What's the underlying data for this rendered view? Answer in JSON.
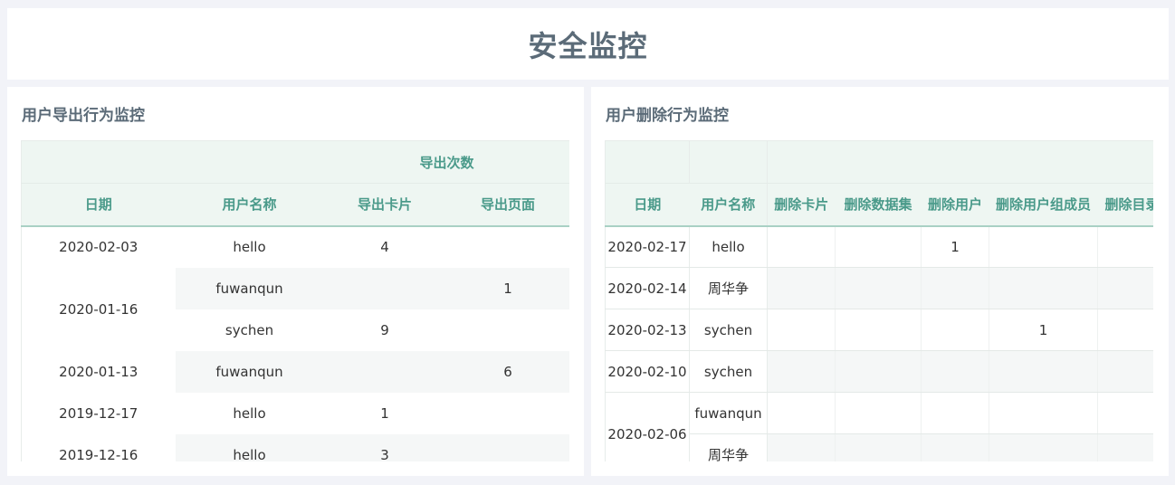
{
  "page": {
    "title": "安全监控"
  },
  "export_panel": {
    "title": "用户导出行为监控",
    "group_header": "导出次数",
    "columns": [
      "日期",
      "用户名称",
      "导出卡片",
      "导出页面"
    ],
    "rows": [
      {
        "date": "2020-02-03",
        "user": "hello",
        "cards": "4",
        "pages": ""
      },
      {
        "date": "2020-01-16",
        "user": "fuwanqun",
        "cards": "",
        "pages": "1"
      },
      {
        "date": "",
        "user": "sychen",
        "cards": "9",
        "pages": ""
      },
      {
        "date": "2020-01-13",
        "user": "fuwanqun",
        "cards": "",
        "pages": "6"
      },
      {
        "date": "2019-12-17",
        "user": "hello",
        "cards": "1",
        "pages": ""
      },
      {
        "date": "2019-12-16",
        "user": "hello",
        "cards": "3",
        "pages": ""
      }
    ]
  },
  "delete_panel": {
    "title": "用户删除行为监控",
    "columns": [
      "日期",
      "用户名称",
      "删除卡片",
      "删除数据集",
      "删除用户",
      "删除用户组成员",
      "删除目录"
    ],
    "rows": [
      {
        "date": "2020-02-17",
        "user": "hello",
        "vals": [
          "",
          "",
          "1",
          "",
          ""
        ]
      },
      {
        "date": "2020-02-14",
        "user": "周华争",
        "vals": [
          "",
          "",
          "",
          "",
          ""
        ]
      },
      {
        "date": "2020-02-13",
        "user": "sychen",
        "vals": [
          "",
          "",
          "",
          "1",
          ""
        ]
      },
      {
        "date": "2020-02-10",
        "user": "sychen",
        "vals": [
          "",
          "",
          "",
          "",
          ""
        ]
      },
      {
        "date": "2020-02-06",
        "user": "fuwanqun",
        "vals": [
          "",
          "",
          "",
          "",
          ""
        ]
      },
      {
        "date": "",
        "user": "周华争",
        "vals": [
          "",
          "",
          "",
          "",
          ""
        ]
      }
    ]
  }
}
